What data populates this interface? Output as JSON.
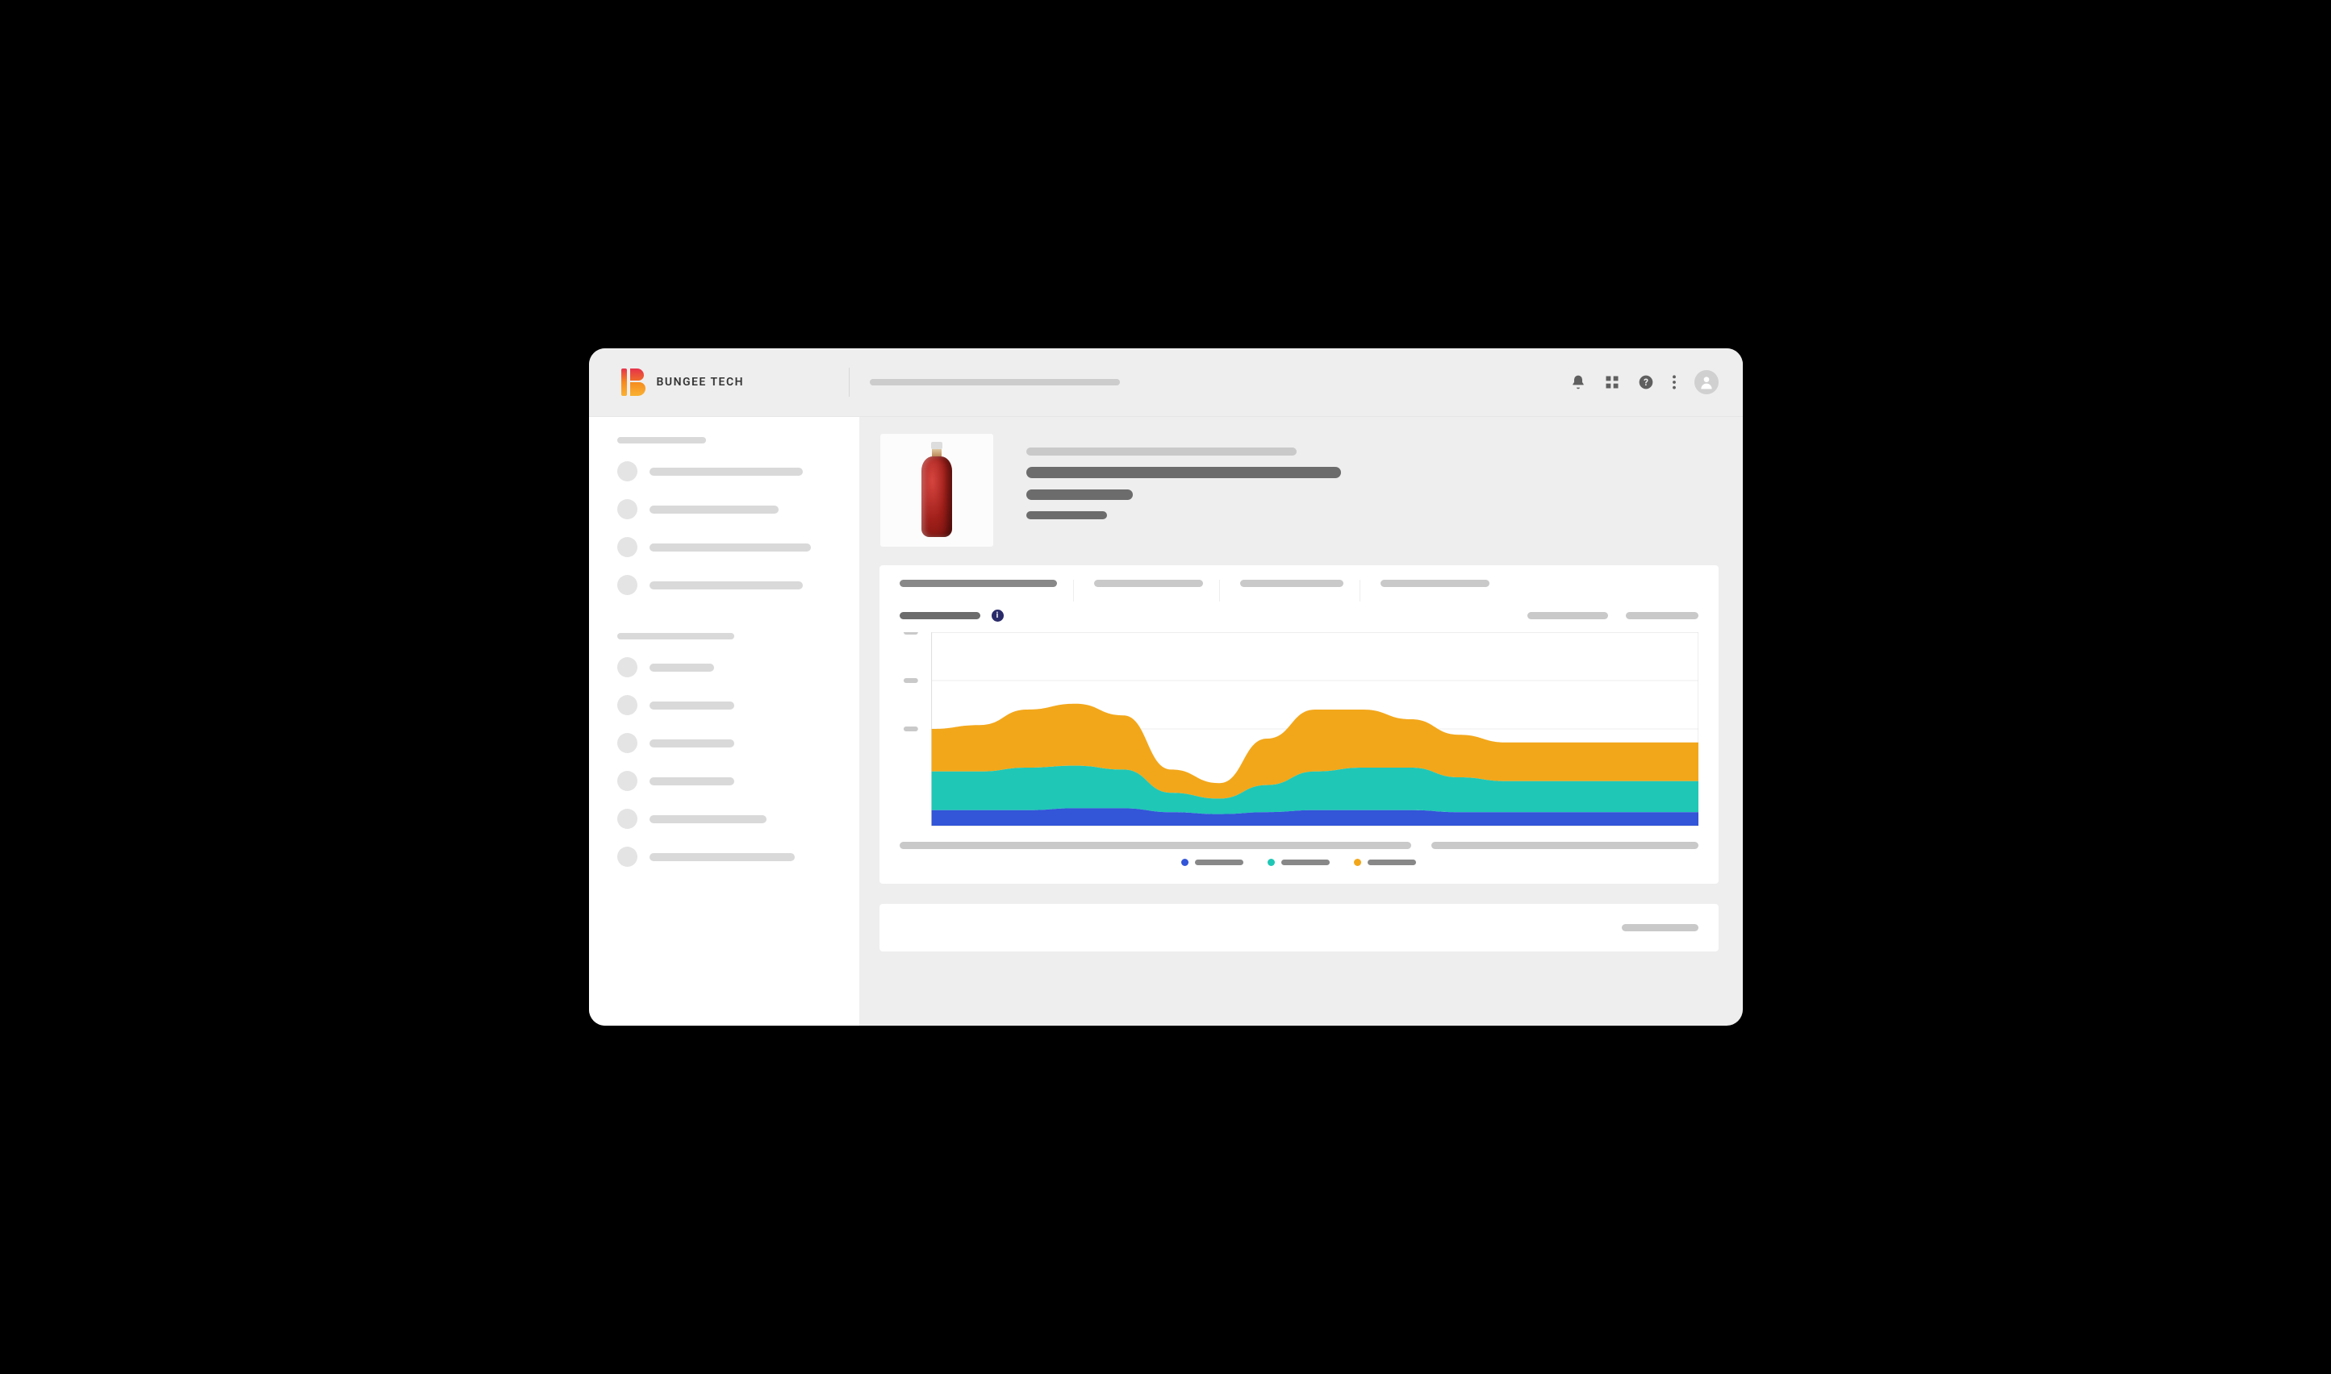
{
  "brand": "BUNGEE TECH",
  "header_icons": [
    "bell-icon",
    "apps-icon",
    "help-icon",
    "more-icon",
    "avatar"
  ],
  "sidebar": {
    "section1_title_width": 110,
    "group1": [
      190,
      160,
      200,
      190
    ],
    "section2_title_width": 145,
    "group2": [
      80,
      105,
      105,
      105,
      145,
      180
    ]
  },
  "product": {
    "meta_lines": [
      334,
      390,
      132,
      100
    ]
  },
  "tabs": [
    {
      "w": 195,
      "active": true
    },
    {
      "w": 135,
      "active": false
    },
    {
      "w": 128,
      "active": false
    },
    {
      "w": 135,
      "active": false
    }
  ],
  "chart_actions": [
    100,
    90
  ],
  "chart_data": {
    "type": "area",
    "title": "",
    "xlabel": "",
    "ylabel": "",
    "ylim": [
      0,
      100
    ],
    "y_ticks": [
      100,
      75,
      50
    ],
    "x": [
      0,
      1,
      2,
      3,
      4,
      5,
      6,
      7,
      8,
      9,
      10,
      11,
      12,
      13,
      14,
      15,
      16
    ],
    "series": [
      {
        "name": "series-a",
        "color": "#3355d8",
        "values": [
          8,
          8,
          8,
          9,
          9,
          7,
          6,
          7,
          8,
          8,
          8,
          7,
          7,
          7,
          7,
          7,
          7
        ]
      },
      {
        "name": "series-b",
        "color": "#1fc7b6",
        "values": [
          20,
          20,
          22,
          22,
          20,
          10,
          8,
          14,
          20,
          22,
          22,
          18,
          16,
          16,
          16,
          16,
          16
        ]
      },
      {
        "name": "series-c",
        "color": "#f2a71b",
        "values": [
          22,
          24,
          30,
          32,
          28,
          12,
          8,
          24,
          32,
          30,
          25,
          22,
          20,
          20,
          20,
          20,
          20
        ]
      }
    ]
  },
  "legend_colors": [
    "#3355d8",
    "#1fc7b6",
    "#f2a71b"
  ],
  "footer_bars": [
    1,
    1
  ],
  "card2_line_width": 95
}
